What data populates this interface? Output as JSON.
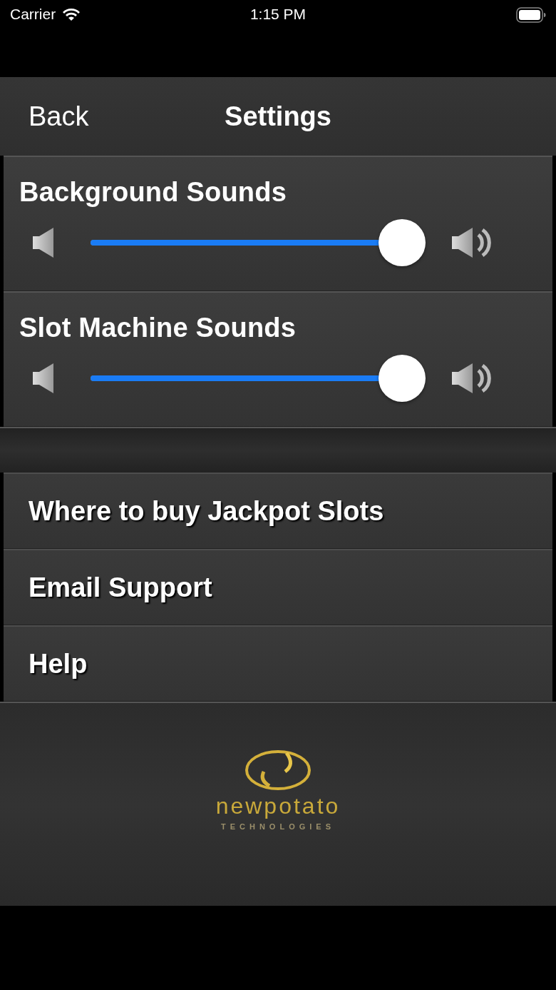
{
  "status_bar": {
    "carrier": "Carrier",
    "time": "1:15 PM"
  },
  "nav_bar": {
    "back": "Back",
    "title": "Settings"
  },
  "sliders": [
    {
      "label": "Background Sounds",
      "level": 1
    },
    {
      "label": "Slot Machine Sounds",
      "level": 1
    }
  ],
  "menu": [
    {
      "label": "Where to buy Jackpot Slots"
    },
    {
      "label": "Email Support"
    },
    {
      "label": "Help"
    }
  ],
  "logo": {
    "name": "newpotato",
    "tagline": "TECHNOLOGIES"
  }
}
